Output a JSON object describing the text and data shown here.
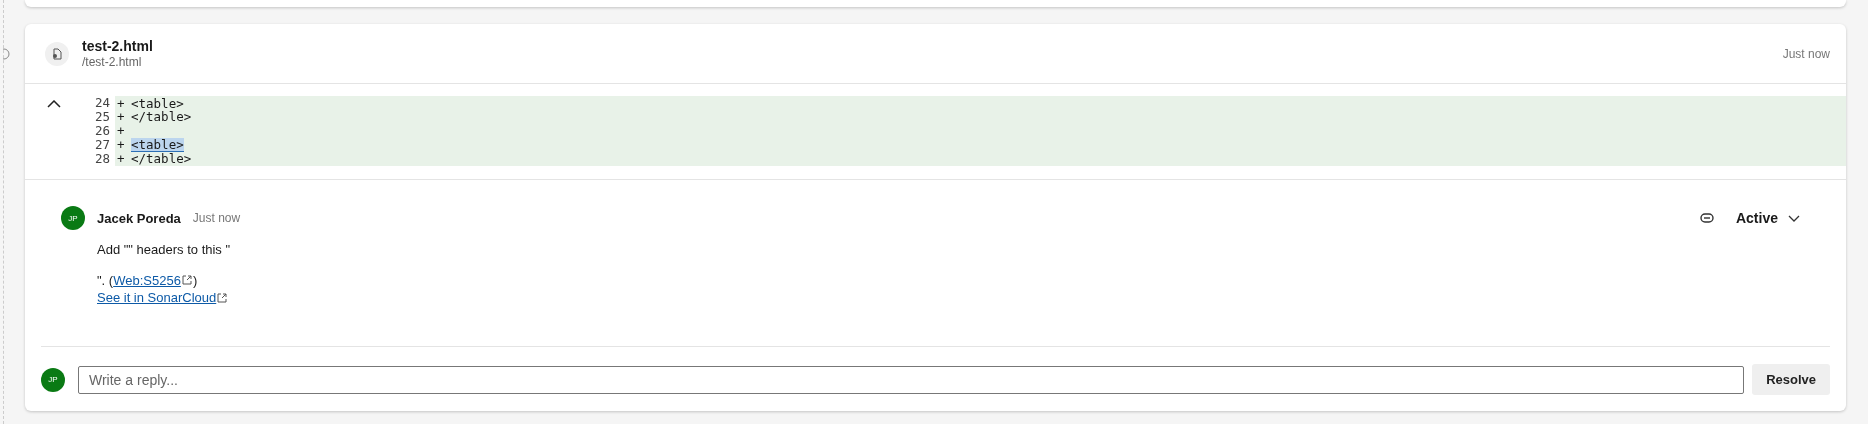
{
  "file": {
    "name": "test-2.html",
    "path": "/test-2.html",
    "time": "Just now"
  },
  "diff": {
    "expanded": true,
    "lines": [
      {
        "number": "24",
        "marker": "+",
        "code": "<table>"
      },
      {
        "number": "25",
        "marker": "+",
        "code": "</table>"
      },
      {
        "number": "26",
        "marker": "+"
      },
      {
        "number": "27",
        "marker": "+",
        "code": "<table>",
        "highlighted": true
      },
      {
        "number": "28",
        "marker": "+",
        "code": "</table>"
      }
    ]
  },
  "comment": {
    "avatar": "JP",
    "author": "Jacek Poreda",
    "time": "Just now",
    "status": "Active",
    "message": "Add \"\" headers to this \"",
    "rule_prefix": "\". (",
    "rule_link": "Web:S5256",
    "rule_suffix": ")",
    "source_link": "See it in SonarCloud"
  },
  "reply": {
    "avatar": "JP",
    "placeholder": "Write a reply...",
    "button": "Resolve"
  }
}
